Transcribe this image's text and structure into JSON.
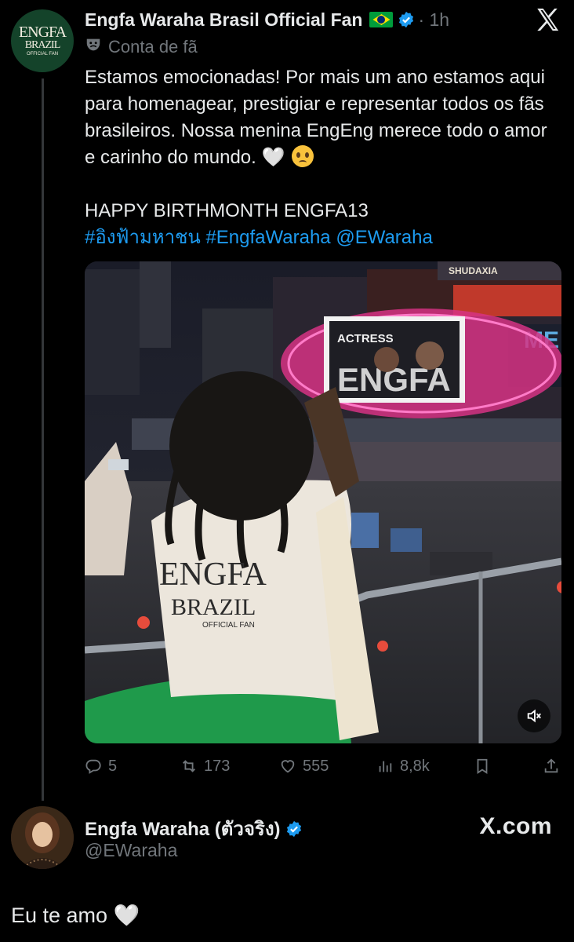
{
  "tweet": {
    "author_name": "Engfa Waraha Brasil Official Fan",
    "time": "· 1h",
    "fan_label": "Conta de fã",
    "avatar_text": {
      "line1": "ENGFA",
      "line2": "BRAZIL",
      "line3": "OFFICIAL FAN"
    },
    "paragraph1": "Estamos emocionadas! Por mais um ano estamos aqui para homenagear, prestigiar e representar todos os fãs brasileiros. Nossa menina EngEng merece todo o amor e carinho do mundo.",
    "heart": "🤍",
    "paragraph2": "HAPPY BIRTHMONTH ENGFA13",
    "hashtag1": "#อิงฟ้ามหาชน",
    "hashtag2": "#EngfaWaraha",
    "mention": "@EWaraha",
    "media": {
      "billboard_word1": "ACTRESS",
      "billboard_word2": "ENGFA",
      "store_sign": "SHUDAXIA",
      "side_sign": "ME",
      "shirt_line1": "ENGFA",
      "shirt_line2": "BRAZIL",
      "shirt_line3": "OFFICIAL FAN"
    },
    "stats": {
      "replies": "5",
      "reposts": "173",
      "likes": "555",
      "views": "8,8k"
    }
  },
  "reply": {
    "author_name": "Engfa Waraha (ตัวจริง)",
    "handle": "@EWaraha",
    "text": "Eu te amo 🤍"
  },
  "brand": "X.com",
  "colors": {
    "background": "#000000",
    "text": "#e7e9ea",
    "muted": "#71767b",
    "link": "#1d9bf0",
    "verified": "#1d9bf0"
  },
  "icons": [
    "close-icon",
    "mask-icon",
    "verified-icon",
    "reply-icon",
    "repost-icon",
    "like-icon",
    "views-icon",
    "bookmark-icon",
    "share-icon",
    "mute-icon"
  ]
}
